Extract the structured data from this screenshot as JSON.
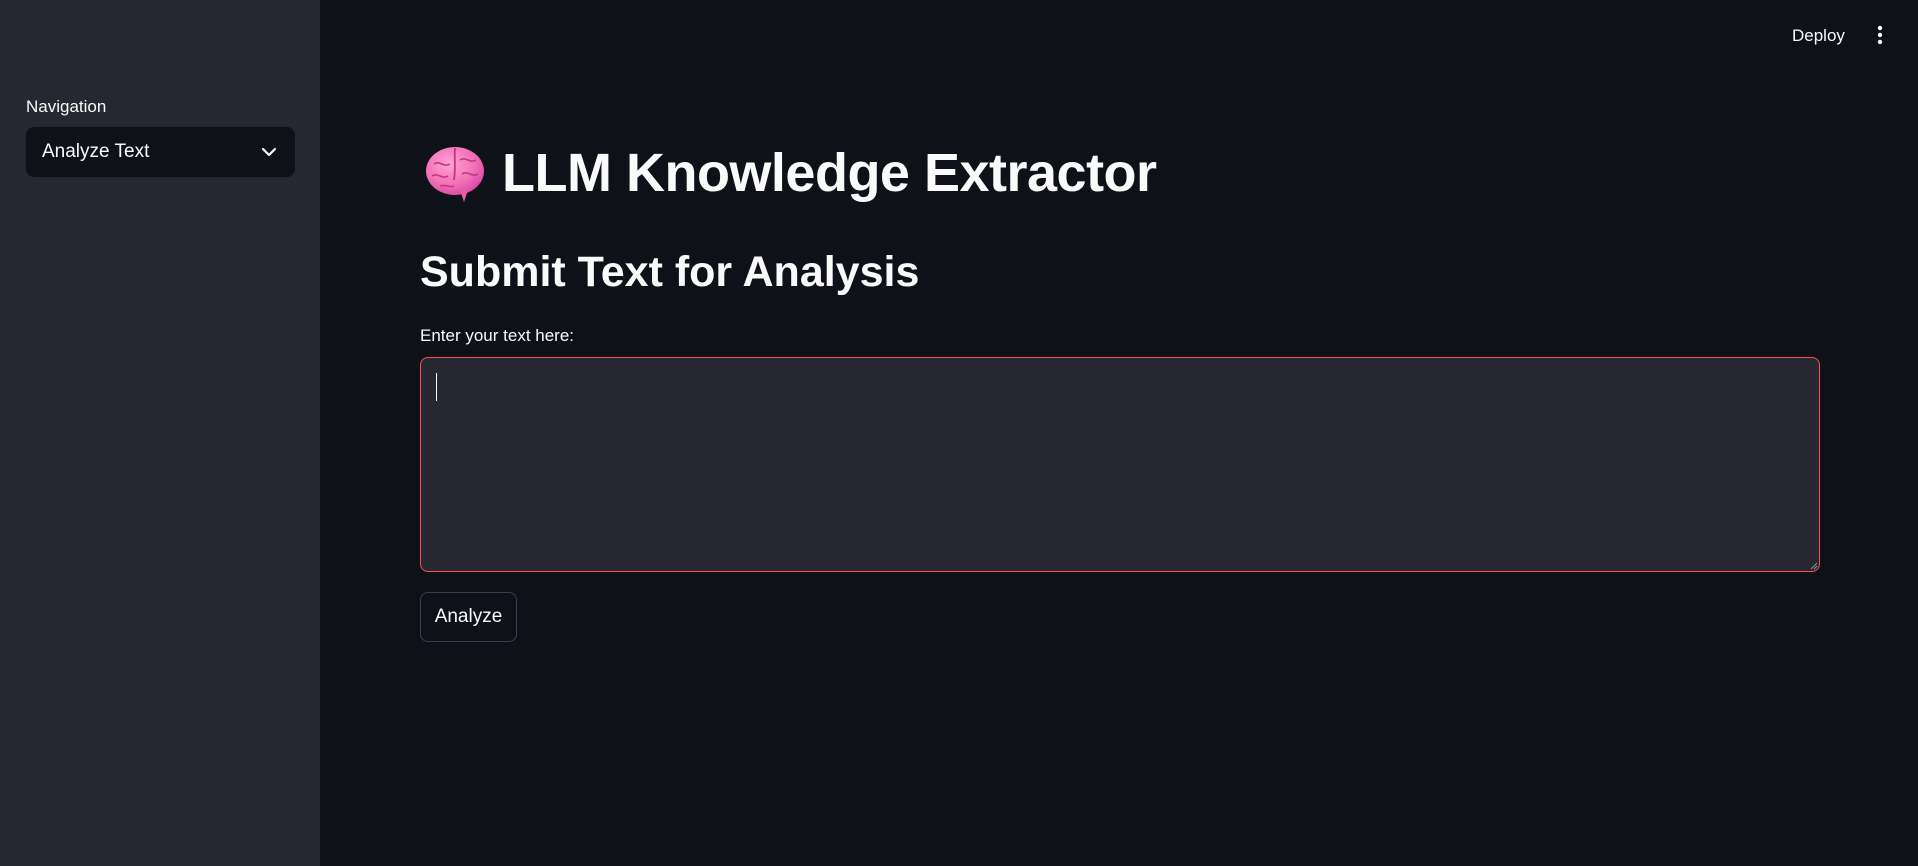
{
  "sidebar": {
    "navigation_label": "Navigation",
    "select_value": "Analyze Text",
    "select_icon": "chevron-down-icon"
  },
  "header": {
    "deploy_label": "Deploy",
    "menu_icon": "vertical-dots-icon"
  },
  "main": {
    "title_icon": "brain-icon",
    "title": "LLM Knowledge Extractor",
    "subheader": "Submit Text for Analysis",
    "input_label": "Enter your text here:",
    "input_value": "",
    "button_label": "Analyze"
  },
  "colors": {
    "background": "#0e1117",
    "sidebar": "#262730",
    "input_bg": "#262730",
    "focus_border": "#ff4b4b",
    "text": "#fafafa",
    "brain_pink": "#f472b6"
  }
}
